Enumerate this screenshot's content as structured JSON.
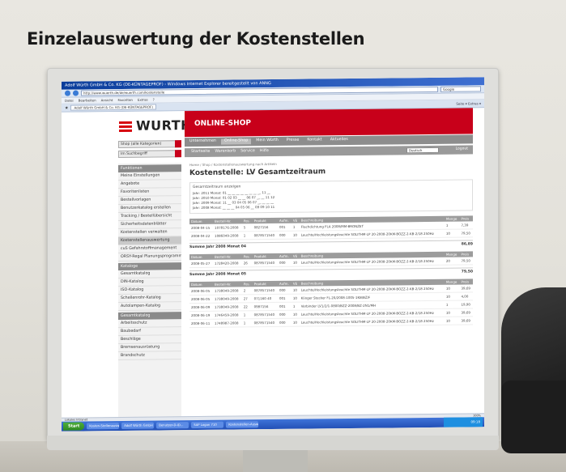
{
  "caption": "Einzelauswertung der Kostenstellen",
  "browser": {
    "title": "Adolf Würth GmbH & Co. KG (DE-KÜNTAGEPROF) - Windows Internet Explorer bereitgestellt von ANNG",
    "url": "http://www.wuerth.de/de/wuerth.com/kostenstelle",
    "search_placeholder": "Google",
    "menu": [
      "Datei",
      "Bearbeiten",
      "Ansicht",
      "Favoriten",
      "Extras",
      "?"
    ],
    "tab_label": "Adolf Würth GmbH & Co. KG (DE-KÜNTAGEPROF)",
    "tools": "Seite ▾  Extras ▾"
  },
  "shop": {
    "logo_text": "WURTH",
    "title": "ONLINE-SHOP",
    "shop_select": "Shop (alle Kategorien)",
    "search_select": "Im Suchbegriff",
    "top_nav": [
      "Unternehmen",
      "Online-Shop",
      "Mein Würth",
      "Presse",
      "Kontakt",
      "Aktuelles"
    ],
    "top_nav_active": "Online-Shop",
    "sub_nav": [
      "Startseite",
      "Warenkorb",
      "Service",
      "Hilfe"
    ],
    "language": "Deutsch",
    "logout": "Logout"
  },
  "sidebar": {
    "sections": [
      {
        "header": "Funktionen",
        "items": [
          "Meine Einstellungen",
          "Angebote",
          "Favoritenlisten",
          "Bestellvorlagen",
          "Benutzerkatalog erstellen",
          "Tracking / Bestellübersicht",
          "Sicherheitsdatenblätter",
          "Kostenstellen verwalten",
          "Kostenstellenauswertung",
          "cuS Gefahrstoffmanagement",
          "ORSY-Regal Planungsprogramm"
        ],
        "highlight": "Kostenstellenauswertung"
      },
      {
        "header": "Kataloge",
        "items": [
          "Gesamtkatalog",
          "DIN-Katalog",
          "ISO-Katalog",
          "Schellenrohr-Katalog",
          "Autolampen-Katalog"
        ]
      },
      {
        "header": "Gesamtkatalog",
        "items": [
          "Arbeitsschutz",
          "Baubedarf",
          "Beschläge",
          "Bremsenausrüstung",
          "Brandschutz"
        ]
      }
    ]
  },
  "main": {
    "breadcrumb": "Home / Shop / Kostenstellenauswertung nach Artikeln",
    "heading": "Kostenstelle: LV    Gesamtzeitraum",
    "period_title": "Gesamtzeitraum anzeigen",
    "period_rows": [
      "Jahr: 2011  Monat: 01  __  __  __  __  __  __  __  __  11  __",
      "Jahr: 2010  Monat: 01  02  03  __  __  06  07  __  __  11  12",
      "Jahr: 2009  Monat: 11  __  03  04  05  06  07  __  __  __  __",
      "Jahr: 2008  Monat:  __  __  __  04  05  06  __  08  09  10  11"
    ],
    "columns": [
      "Datum",
      "Bestell-Nr.",
      "Pos.",
      "Produkt",
      "Aufm.",
      "VE",
      "Beschreibung",
      "Menge",
      "Preis"
    ],
    "tables": [
      {
        "rows": [
          [
            "2008-04-15",
            "1078176-2008",
            "5",
            "0827156",
            "001",
            "1",
            "Flachdichtung FLA 2008/MM-BRONZET",
            "1",
            "7,39"
          ],
          [
            "2008-04-22",
            "1086049-2008",
            "1",
            "0878571540",
            "000",
            "10",
            "Leuchte/Hochleistungsleuchte SOLITHM-LP 20-2008-20KM-BOZZ-2-KB-2/18 250Hz",
            "10",
            "79,50"
          ]
        ],
        "sum_label": "Summe Jahr 2008 Monat 04",
        "sum_value": "86,89"
      },
      {
        "rows": [
          [
            "2008-05-27",
            "1728420-2008",
            "26",
            "0878571540",
            "000",
            "10",
            "Leuchte/Hochleistungsleuchte SOLITHM-LP 20-2008-20KM-BOZZ-2-KB-2/18 250Hz",
            "20",
            "79,50"
          ]
        ],
        "sum_label": "Summe Jahr 2008 Monat 05",
        "sum_value": "79,50"
      },
      {
        "rows": [
          [
            "2008-06-05",
            "1738049-2008",
            "2",
            "0878571540",
            "000",
            "10",
            "Leuchte/Hochleistungsleuchte SOLITHM-LP 20-2008-20KM-BOZZ-2-KB-2/18 250Hz",
            "10",
            "39,69"
          ],
          [
            "2008-06-05",
            "1738049-2008",
            "27",
            "071160 40",
            "001",
            "10",
            "Klinger Stecker FL-20/2008-1005-1KB/BZ/F",
            "10",
            "4,00"
          ],
          [
            "2008-06-09",
            "1738049-2008",
            "22",
            "0987156",
            "001",
            "1",
            "Verbinder LV1/2/1-0800/BZZ-2008/BZ-2N1/MH",
            "1",
            "19,90"
          ],
          [
            "2008-06-19",
            "1746459-2008",
            "1",
            "0878571540",
            "000",
            "10",
            "Leuchte/Hochleistungsleuchte SOLITHM-LP 20-2008-20KM-BOZZ-2-KB-2/18 250Hz",
            "10",
            "39,69"
          ],
          [
            "2008-06-11",
            "1748987-2008",
            "1",
            "0878571540",
            "000",
            "10",
            "Leuchte/Hochleistungsleuchte SOLITHM-LP 20-2008-20KM-BOZZ-2-KB-2/18 250Hz",
            "10",
            "39,69"
          ]
        ]
      }
    ]
  },
  "status_bar": "Lokales Intranet",
  "zoom": "100%",
  "taskbar": {
    "start": "Start",
    "tasks": [
      "Kosten-Stellenauswertung",
      "Adolf Würth GmbH & Co. KG",
      "Benutzer-D-ID...",
      "SAP Logon 710",
      "Kostenstellen-Auswertung"
    ],
    "clock": "09:18"
  }
}
